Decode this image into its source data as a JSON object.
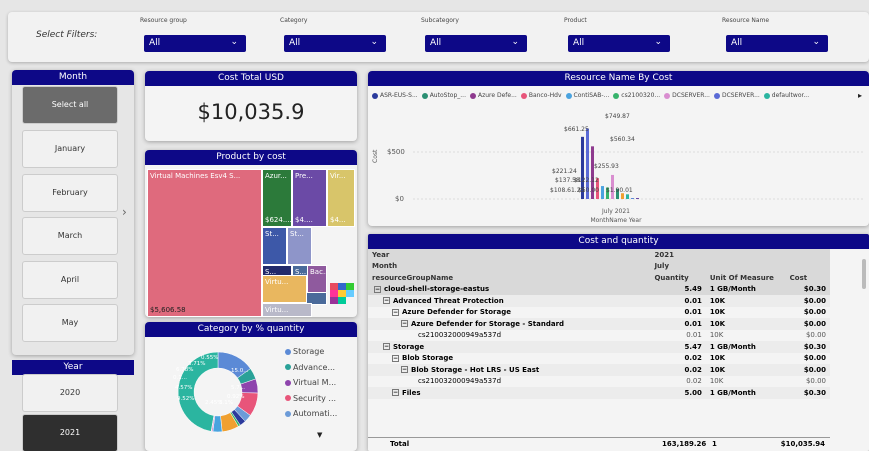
{
  "filters": {
    "label": "Select Filters:",
    "items": [
      {
        "label": "Resource group",
        "value": "All"
      },
      {
        "label": "Category",
        "value": "All"
      },
      {
        "label": "Subcategory",
        "value": "All"
      },
      {
        "label": "Product",
        "value": "All"
      },
      {
        "label": "Resource Name",
        "value": "All"
      }
    ]
  },
  "month": {
    "title": "Month",
    "select_all": "Select all",
    "items": [
      "January",
      "February",
      "March",
      "April",
      "May"
    ]
  },
  "year": {
    "title": "Year",
    "items": [
      "2020",
      "2021"
    ]
  },
  "cost_total": {
    "title": "Cost Total USD",
    "value": "$10,035.9"
  },
  "product_by_cost": {
    "title": "Product by cost",
    "tiles": [
      {
        "label": "Virtual Machines Esv4 S...",
        "value": "$5,606.58",
        "color": "#df6a7d"
      },
      {
        "label": "Azur...",
        "value": "$624....",
        "color": "#2c7a3a"
      },
      {
        "label": "Pre...",
        "value": "$4....",
        "color": "#6b4aa6"
      },
      {
        "label": "Vir...",
        "value": "$4...",
        "color": "#d8c56a"
      },
      {
        "label": "St...",
        "value": "",
        "color": "#3d58a8"
      },
      {
        "label": "St...",
        "value": "",
        "color": "#8e95c9"
      },
      {
        "label": "S...",
        "value": "",
        "color": "#222a6b"
      },
      {
        "label": "S...",
        "value": "",
        "color": "#4a6a9a"
      },
      {
        "label": "Virtu...",
        "value": "",
        "color": "#e9b75f"
      },
      {
        "label": "Bac...",
        "value": "",
        "color": "#8f5a9e"
      },
      {
        "label": "Virtu...",
        "value": "",
        "color": "#b9b9c9"
      }
    ]
  },
  "category": {
    "title": "Category by % quantity",
    "donut_labels": [
      "0.55%",
      "3.71%",
      "6.78%",
      "15.0...",
      "0.1...",
      "4.57%",
      "5.7...",
      "9.52%",
      "0.92%",
      "2.45%",
      "3.1%"
    ],
    "legend": [
      {
        "name": "Storage",
        "color": "#5b8ad6"
      },
      {
        "name": "Advance...",
        "color": "#2aa198"
      },
      {
        "name": "Virtual M...",
        "color": "#8e44ad"
      },
      {
        "name": "Security ...",
        "color": "#e8557a"
      },
      {
        "name": "Automati...",
        "color": "#6c9bd8"
      }
    ],
    "more": "▼"
  },
  "resource_chart": {
    "title": "Resource Name By Cost",
    "legend": [
      {
        "name": "ASR-EUS-S...",
        "color": "#2b3a9c"
      },
      {
        "name": "AutoStop_...",
        "color": "#2a8f72"
      },
      {
        "name": "Azure Defe...",
        "color": "#8e3a8e"
      },
      {
        "name": "Banco-Hdv",
        "color": "#e8557a"
      },
      {
        "name": "ContiSAB-...",
        "color": "#4aa3df"
      },
      {
        "name": "cs2100320...",
        "color": "#36b36b"
      },
      {
        "name": "DCSERVER...",
        "color": "#d98ed0"
      },
      {
        "name": "DCSERVER...",
        "color": "#5a6ad6"
      },
      {
        "name": "defaultwor...",
        "color": "#2bb5a0"
      }
    ],
    "more": "▸",
    "ylabel": "Cost",
    "yticks": [
      "$500",
      "$0"
    ],
    "xtick": "July 2021",
    "xlabel": "MonthName Year",
    "data_labels": [
      "$661.25",
      "$749.87",
      "$560.34",
      "$221.24",
      "$137.58",
      "$122.12",
      "$255.93",
      "$108.61.25",
      "$50.00",
      "$1.90.01"
    ]
  },
  "chart_data": {
    "type": "bar",
    "title": "Resource Name By Cost",
    "xlabel": "MonthName Year",
    "ylabel": "Cost",
    "categories": [
      "July 2021"
    ],
    "series_values": [
      661.25,
      749.87,
      560.34,
      221.24,
      137.58,
      122.12,
      255.93,
      108.61,
      61.25,
      50.0,
      0.01,
      0.01
    ],
    "ylim": [
      0,
      800
    ]
  },
  "cost_quantity": {
    "title": "Cost and quantity",
    "header": [
      [
        "Year",
        "2021",
        "",
        ""
      ],
      [
        "Month",
        "July",
        "",
        ""
      ],
      [
        "resourceGroupName",
        "Quantity",
        "Unit Of Measure",
        "Cost"
      ]
    ],
    "rows": [
      {
        "level": 0,
        "bold": true,
        "box": "−",
        "name": "cloud-shell-storage-eastus",
        "qty": "5.49",
        "unit": "1 GB/Month",
        "cost": "$0.30"
      },
      {
        "level": 1,
        "bold": true,
        "box": "−",
        "name": "Advanced Threat Protection",
        "qty": "0.01",
        "unit": "10K",
        "cost": "$0.00"
      },
      {
        "level": 2,
        "bold": true,
        "box": "−",
        "name": "Azure Defender for Storage",
        "qty": "0.01",
        "unit": "10K",
        "cost": "$0.00"
      },
      {
        "level": 3,
        "bold": true,
        "box": "−",
        "name": "Azure Defender for Storage - Standard",
        "qty": "0.01",
        "unit": "10K",
        "cost": "$0.00"
      },
      {
        "level": 4,
        "bold": false,
        "box": "",
        "name": "cs210032000949a537d",
        "qty": "0.01",
        "unit": "10K",
        "cost": "$0.00"
      },
      {
        "level": 1,
        "bold": true,
        "box": "−",
        "name": "Storage",
        "qty": "5.47",
        "unit": "1 GB/Month",
        "cost": "$0.30"
      },
      {
        "level": 2,
        "bold": true,
        "box": "−",
        "name": "Blob Storage",
        "qty": "0.02",
        "unit": "10K",
        "cost": "$0.00"
      },
      {
        "level": 3,
        "bold": true,
        "box": "−",
        "name": "Blob Storage - Hot LRS - US East",
        "qty": "0.02",
        "unit": "10K",
        "cost": "$0.00"
      },
      {
        "level": 4,
        "bold": false,
        "box": "",
        "name": "cs210032000949a537d",
        "qty": "0.02",
        "unit": "10K",
        "cost": "$0.00"
      },
      {
        "level": 2,
        "bold": true,
        "box": "−",
        "name": "Files",
        "qty": "5.00",
        "unit": "1 GB/Month",
        "cost": "$0.30"
      }
    ],
    "total": {
      "label": "Total",
      "qty": "163,189.26",
      "unit": "1",
      "cost": "$10,035.94"
    }
  }
}
